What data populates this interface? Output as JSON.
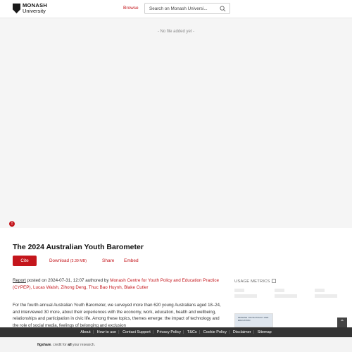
{
  "header": {
    "logo_line1": "MONASH",
    "logo_line2": "University",
    "browse_label": "Browse",
    "search_placeholder": "Search on Monash Universi..."
  },
  "viewer": {
    "empty_message": "- No file added yet -"
  },
  "item": {
    "title": "The 2024 Australian Youth Barometer",
    "cite_label": "Cite",
    "download_label": "Download",
    "download_size": "(3.39 MB)",
    "share_label": "Share",
    "embed_label": "Embed",
    "type_label": "Report",
    "posted_text": "posted on 2024-07-31, 12:07 authored by",
    "authors": "Monash Centre for Youth Policy and Education Practice (CYPEP), Lucas Walsh, Zihong Deng, Thuc Bao Huynh, Blake Cutler",
    "description": "For the fourth annual Australian Youth Barometer, we surveyed more than 620 young Australians aged 18–24, and interviewed 30 more, about their experiences with the economy, work, education, health and wellbeing, relationships and participation in civic life. Among these topics, themes emerge: the impact of technology and the role of social media, feelings of belonging and exclusion"
  },
  "sidebar": {
    "usage_metrics_label": "USAGE METRICS",
    "thumbnail_text": "MONASH YOUTH POLICY AND EDUCATION"
  },
  "footer": {
    "links": [
      "About",
      "How to use",
      "Contact Support",
      "Privacy Policy",
      "T&Cs",
      "Cookie Policy",
      "Disclaimer",
      "Sitemap"
    ],
    "figshare_brand": "figshare",
    "figshare_text": ". credit for",
    "figshare_all": "all",
    "figshare_tail": "your research."
  },
  "colors": {
    "accent": "#c4161c",
    "footer_bg": "#333333",
    "viewer_bg": "#f5f5f5"
  },
  "icons": [
    "monash-crest-icon",
    "search-icon",
    "alert-icon",
    "external-link-icon",
    "chevron-up-icon"
  ]
}
